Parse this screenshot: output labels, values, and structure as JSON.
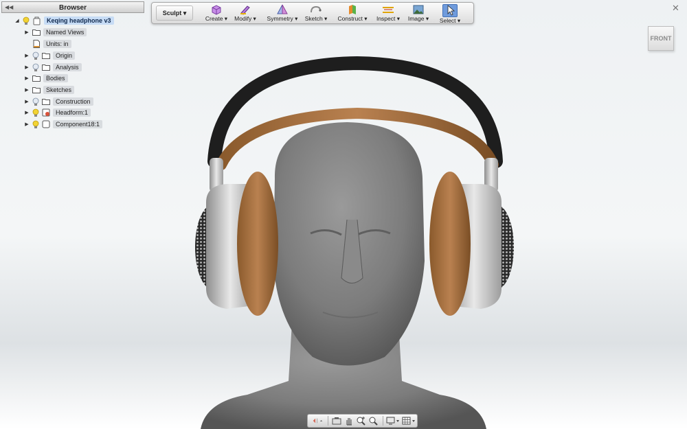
{
  "browser": {
    "title": "Browser",
    "root": "Keqing headphone v3",
    "items": [
      {
        "label": "Named Views"
      },
      {
        "label": "Units: in"
      },
      {
        "label": "Origin"
      },
      {
        "label": "Analysis"
      },
      {
        "label": "Bodies"
      },
      {
        "label": "Sketches"
      },
      {
        "label": "Construction"
      },
      {
        "label": "Headform:1"
      },
      {
        "label": "Component18:1"
      }
    ]
  },
  "toolbar": {
    "workspace": "Sculpt ▾",
    "tools": [
      {
        "label": "Create ▾",
        "icon": "create-box-icon"
      },
      {
        "label": "Modify ▾",
        "icon": "modify-brush-icon"
      },
      {
        "label": "Symmetry ▾",
        "icon": "symmetry-icon"
      },
      {
        "label": "Sketch ▾",
        "icon": "sketch-icon"
      },
      {
        "label": "Construct ▾",
        "icon": "construct-icon"
      },
      {
        "label": "Inspect ▾",
        "icon": "inspect-icon"
      },
      {
        "label": "Image ▾",
        "icon": "image-icon"
      },
      {
        "label": "Select ▾",
        "icon": "select-cursor-icon"
      }
    ]
  },
  "viewcube": {
    "face": "FRONT"
  },
  "colors": {
    "accent": "#6f9bdc",
    "selection": "#c7dcf5",
    "bulb": "#f2d335"
  }
}
